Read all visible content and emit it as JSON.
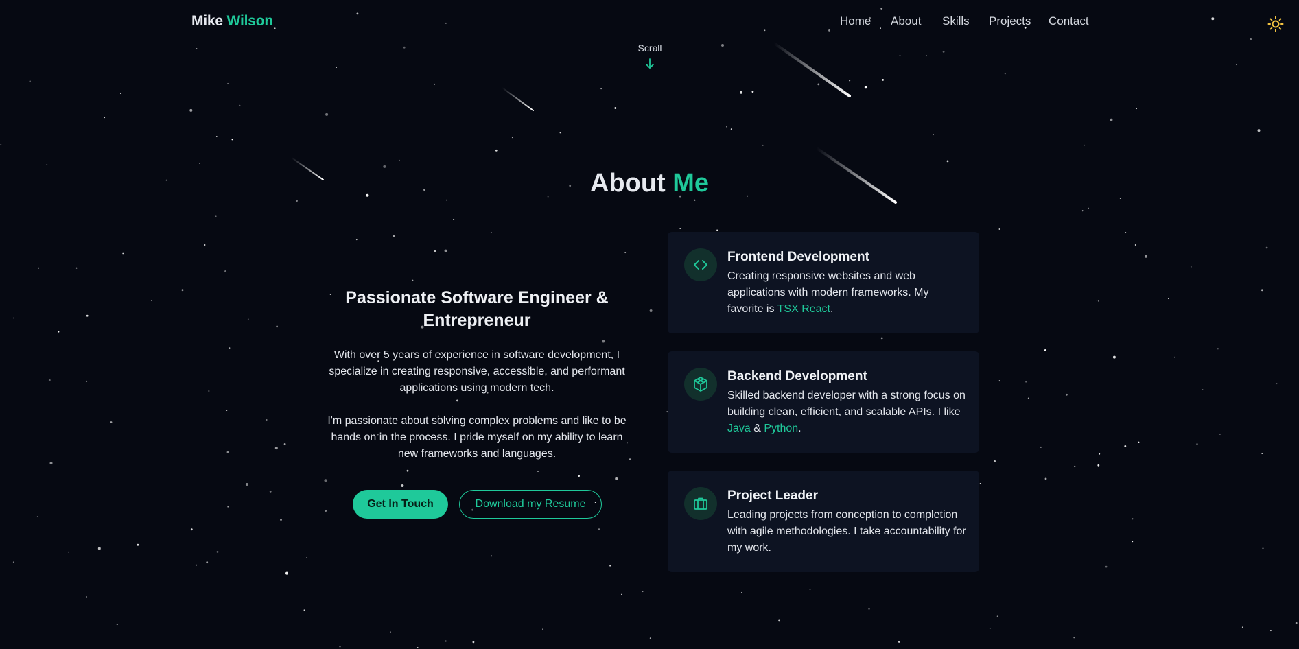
{
  "header": {
    "logo_first": "Mike",
    "logo_last": "Wilson",
    "nav": [
      "Home",
      "About",
      "Skills",
      "Projects",
      "Contact"
    ],
    "theme_icon": "sun-icon",
    "accent_color": "#1fc99a"
  },
  "scroll_hint": {
    "label": "Scroll",
    "icon": "arrow-down-icon"
  },
  "about": {
    "title_main": "About",
    "title_accent": "Me",
    "heading_line1": "Passionate Software Engineer &",
    "heading_line2": "Entrepreneur",
    "para1": "With over 5 years of experience in software development, I specialize in creating responsive, accessible, and performant applications using modern tech.",
    "para2": "I'm passionate about solving complex problems and like to be hands on in the process. I pride myself on my ability to learn new frameworks and languages.",
    "primary_button": "Get In Touch",
    "secondary_button": "Download my Resume"
  },
  "cards": [
    {
      "icon": "code-icon",
      "title": "Frontend Development",
      "desc_before": "Creating responsive websites and web applications with modern frameworks. My favorite is ",
      "highlight": "TSX React",
      "desc_after": "."
    },
    {
      "icon": "cube-icon",
      "title": "Backend Development",
      "desc_before": "Skilled backend developer with a strong focus on building clean, efficient, and scalable APIs. I like ",
      "highlight1": "Java",
      "connector": " & ",
      "highlight2": "Python",
      "desc_after": "."
    },
    {
      "icon": "briefcase-icon",
      "title": "Project Leader",
      "desc": "Leading projects from conception to completion with agile methodologies. I take accountability for my work."
    }
  ]
}
